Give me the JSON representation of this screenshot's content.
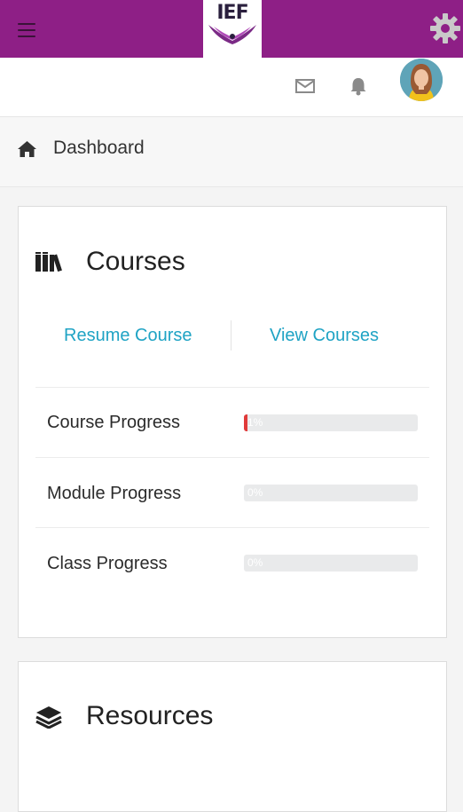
{
  "header": {
    "logo_text": "IEF",
    "accent_color": "#8e1f86",
    "icons": [
      "hamburger-icon",
      "gear-icon",
      "mail-icon",
      "bell-icon",
      "avatar"
    ]
  },
  "breadcrumb": {
    "label": "Dashboard",
    "icon": "home-icon"
  },
  "courses": {
    "title": "Courses",
    "icon": "books-icon",
    "resume_label": "Resume Course",
    "view_label": "View Courses",
    "progress": [
      {
        "label": "Course Progress",
        "value": 1,
        "text": "1%"
      },
      {
        "label": "Module Progress",
        "value": 0,
        "text": "0%"
      },
      {
        "label": "Class Progress",
        "value": 0,
        "text": "0%"
      }
    ]
  },
  "resources": {
    "title": "Resources",
    "icon": "layers-icon"
  },
  "colors": {
    "link": "#1fa3c4",
    "progress_fill": "#e03a3a",
    "progress_track": "#e9eaeb"
  }
}
